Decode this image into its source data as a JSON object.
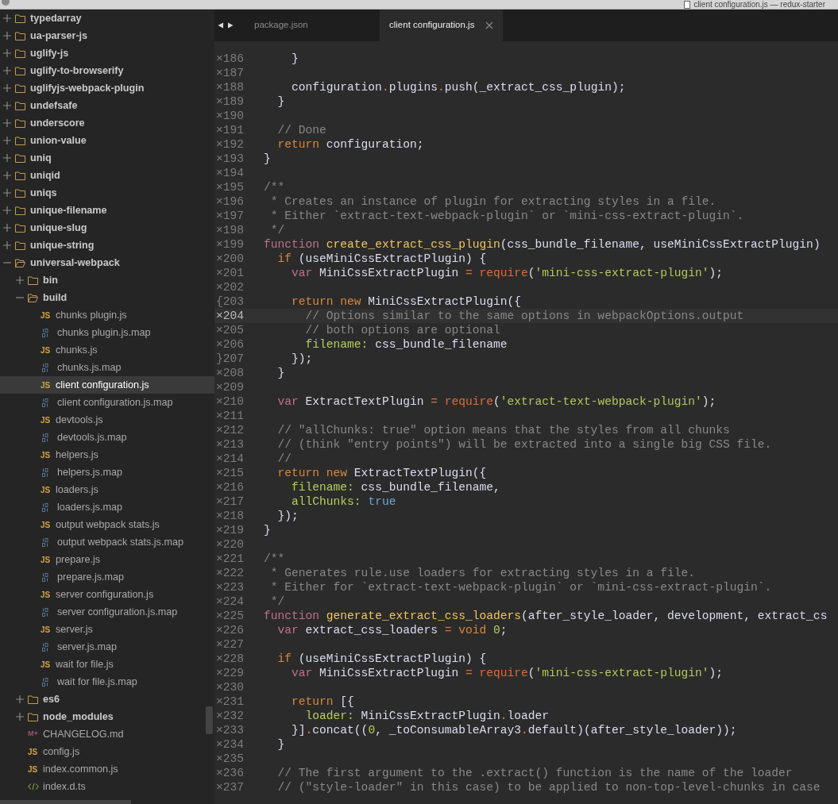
{
  "window": {
    "title": "client configuration.js — redux-starter"
  },
  "sidebar": {
    "items": [
      {
        "kind": "folder",
        "label": "typedarray",
        "expanded": false,
        "selected": false
      },
      {
        "kind": "folder",
        "label": "ua-parser-js",
        "expanded": false,
        "selected": false
      },
      {
        "kind": "folder",
        "label": "uglify-js",
        "expanded": false,
        "selected": false
      },
      {
        "kind": "folder",
        "label": "uglify-to-browserify",
        "expanded": false,
        "selected": false
      },
      {
        "kind": "folder",
        "label": "uglifyjs-webpack-plugin",
        "expanded": false,
        "selected": false
      },
      {
        "kind": "folder",
        "label": "undefsafe",
        "expanded": false,
        "selected": false
      },
      {
        "kind": "folder",
        "label": "underscore",
        "expanded": false,
        "selected": false
      },
      {
        "kind": "folder",
        "label": "union-value",
        "expanded": false,
        "selected": false
      },
      {
        "kind": "folder",
        "label": "uniq",
        "expanded": false,
        "selected": false
      },
      {
        "kind": "folder",
        "label": "uniqid",
        "expanded": false,
        "selected": false
      },
      {
        "kind": "folder",
        "label": "uniqs",
        "expanded": false,
        "selected": false
      },
      {
        "kind": "folder",
        "label": "unique-filename",
        "expanded": false,
        "selected": false
      },
      {
        "kind": "folder",
        "label": "unique-slug",
        "expanded": false,
        "selected": false
      },
      {
        "kind": "folder",
        "label": "unique-string",
        "expanded": false,
        "selected": false
      },
      {
        "kind": "folder",
        "label": "universal-webpack",
        "expanded": true,
        "selected": false,
        "children": [
          {
            "kind": "folder",
            "label": "bin",
            "expanded": false,
            "selected": false
          },
          {
            "kind": "folder",
            "label": "build",
            "expanded": true,
            "selected": false,
            "children": [
              {
                "kind": "js",
                "icon_text": "JS",
                "label": "chunks plugin.js",
                "selected": false
              },
              {
                "kind": "map",
                "label": "chunks plugin.js.map",
                "selected": false
              },
              {
                "kind": "js",
                "icon_text": "JS",
                "label": "chunks.js",
                "selected": false
              },
              {
                "kind": "map",
                "label": "chunks.js.map",
                "selected": false
              },
              {
                "kind": "js",
                "icon_text": "JS",
                "label": "client configuration.js",
                "selected": true
              },
              {
                "kind": "map",
                "label": "client configuration.js.map",
                "selected": false
              },
              {
                "kind": "js",
                "icon_text": "JS",
                "label": "devtools.js",
                "selected": false
              },
              {
                "kind": "map",
                "label": "devtools.js.map",
                "selected": false
              },
              {
                "kind": "js",
                "icon_text": "JS",
                "label": "helpers.js",
                "selected": false
              },
              {
                "kind": "map",
                "label": "helpers.js.map",
                "selected": false
              },
              {
                "kind": "js",
                "icon_text": "JS",
                "label": "loaders.js",
                "selected": false
              },
              {
                "kind": "map",
                "label": "loaders.js.map",
                "selected": false
              },
              {
                "kind": "js",
                "icon_text": "JS",
                "label": "output webpack stats.js",
                "selected": false
              },
              {
                "kind": "map",
                "label": "output webpack stats.js.map",
                "selected": false
              },
              {
                "kind": "js",
                "icon_text": "JS",
                "label": "prepare.js",
                "selected": false
              },
              {
                "kind": "map",
                "label": "prepare.js.map",
                "selected": false
              },
              {
                "kind": "js",
                "icon_text": "JS",
                "label": "server configuration.js",
                "selected": false
              },
              {
                "kind": "map",
                "label": "server configuration.js.map",
                "selected": false
              },
              {
                "kind": "js",
                "icon_text": "JS",
                "label": "server.js",
                "selected": false
              },
              {
                "kind": "map",
                "label": "server.js.map",
                "selected": false
              },
              {
                "kind": "js",
                "icon_text": "JS",
                "label": "wait for file.js",
                "selected": false
              },
              {
                "kind": "map",
                "label": "wait for file.js.map",
                "selected": false
              }
            ]
          },
          {
            "kind": "folder",
            "label": "es6",
            "expanded": false,
            "selected": false
          },
          {
            "kind": "folder",
            "label": "node_modules",
            "expanded": false,
            "selected": false
          },
          {
            "kind": "md",
            "icon_text": "M+",
            "label": "CHANGELOG.md",
            "selected": false
          },
          {
            "kind": "js",
            "icon_text": "JS",
            "label": "config.js",
            "selected": false
          },
          {
            "kind": "js",
            "icon_text": "JS",
            "label": "index.common.js",
            "selected": false
          },
          {
            "kind": "ts",
            "label": "index.d.ts",
            "selected": false
          }
        ]
      }
    ]
  },
  "tabs": [
    {
      "label": "package.json",
      "selected": false
    },
    {
      "label": "client configuration.js",
      "selected": true
    }
  ],
  "editor": {
    "lines": [
      {
        "marker": "×",
        "number": "186",
        "current": false,
        "tokens": [
          {
            "kind": "plain",
            "text": "    }"
          }
        ]
      },
      {
        "marker": "×",
        "number": "187",
        "current": false
      },
      {
        "marker": "×",
        "number": "188",
        "current": false,
        "tokens": [
          {
            "kind": "plain",
            "text": "    configuration"
          },
          {
            "kind": "op",
            "text": "."
          },
          {
            "kind": "plain",
            "text": "plugins"
          },
          {
            "kind": "op",
            "text": "."
          },
          {
            "kind": "plain",
            "text": "push(_extract_css_plugin);"
          }
        ]
      },
      {
        "marker": "×",
        "number": "189",
        "current": false,
        "tokens": [
          {
            "kind": "plain",
            "text": "  }"
          }
        ]
      },
      {
        "marker": "×",
        "number": "190",
        "current": false
      },
      {
        "marker": "×",
        "number": "191",
        "current": false,
        "tokens": [
          {
            "kind": "comment",
            "text": "  // Done"
          }
        ]
      },
      {
        "marker": "×",
        "number": "192",
        "current": false,
        "tokens": [
          {
            "kind": "keyword",
            "text": "  return"
          },
          {
            "kind": "plain",
            "text": " configuration;"
          }
        ]
      },
      {
        "marker": "×",
        "number": "193",
        "current": false,
        "tokens": [
          {
            "kind": "plain",
            "text": "}"
          }
        ]
      },
      {
        "marker": "×",
        "number": "194",
        "current": false
      },
      {
        "marker": "×",
        "number": "195",
        "current": false,
        "tokens": [
          {
            "kind": "comment",
            "text": "/**"
          }
        ]
      },
      {
        "marker": "×",
        "number": "196",
        "current": false,
        "tokens": [
          {
            "kind": "comment",
            "text": " * Creates an instance of plugin for extracting styles in a file."
          }
        ]
      },
      {
        "marker": "×",
        "number": "197",
        "current": false,
        "tokens": [
          {
            "kind": "comment",
            "text": " * Either `extract-text-webpack-plugin` or `mini-css-extract-plugin`."
          }
        ]
      },
      {
        "marker": "×",
        "number": "198",
        "current": false,
        "tokens": [
          {
            "kind": "comment",
            "text": " */"
          }
        ]
      },
      {
        "marker": "×",
        "number": "199",
        "current": false,
        "tokens": [
          {
            "kind": "storage",
            "text": "function "
          },
          {
            "kind": "name",
            "text": "create_extract_css_plugin"
          },
          {
            "kind": "plain",
            "text": "(css_bundle_filename, useMiniCssExtractPlugin)"
          }
        ]
      },
      {
        "marker": "×",
        "number": "200",
        "current": false,
        "tokens": [
          {
            "kind": "keyword",
            "text": "  if"
          },
          {
            "kind": "plain",
            "text": " (useMiniCssExtractPlugin) {"
          }
        ]
      },
      {
        "marker": "×",
        "number": "201",
        "current": false,
        "tokens": [
          {
            "kind": "storage",
            "text": "    var"
          },
          {
            "kind": "plain",
            "text": " MiniCssExtractPlugin "
          },
          {
            "kind": "call",
            "text": "= require"
          },
          {
            "kind": "plain",
            "text": "("
          },
          {
            "kind": "string",
            "text": "'mini-css-extract-plugin'"
          },
          {
            "kind": "plain",
            "text": ");"
          }
        ]
      },
      {
        "marker": "×",
        "number": "202",
        "current": false
      },
      {
        "marker": "{",
        "number": "203",
        "current": false,
        "tokens": [
          {
            "kind": "keyword",
            "text": "    return new"
          },
          {
            "kind": "plain",
            "text": " MiniCssExtractPlugin({"
          }
        ]
      },
      {
        "marker": "×",
        "number": "204",
        "current": true,
        "tokens": [
          {
            "kind": "comment",
            "text": "      // Options similar to the same options in webpackOptions.output"
          }
        ]
      },
      {
        "marker": "×",
        "number": "205",
        "current": false,
        "tokens": [
          {
            "kind": "comment",
            "text": "      // both options are optional"
          }
        ]
      },
      {
        "marker": "×",
        "number": "206",
        "current": false,
        "tokens": [
          {
            "kind": "key",
            "text": "      filename:"
          },
          {
            "kind": "plain",
            "text": " css_bundle_filename"
          }
        ]
      },
      {
        "marker": "}",
        "number": "207",
        "current": false,
        "tokens": [
          {
            "kind": "plain",
            "text": "    });"
          }
        ]
      },
      {
        "marker": "×",
        "number": "208",
        "current": false,
        "tokens": [
          {
            "kind": "plain",
            "text": "  }"
          }
        ]
      },
      {
        "marker": "×",
        "number": "209",
        "current": false
      },
      {
        "marker": "×",
        "number": "210",
        "current": false,
        "tokens": [
          {
            "kind": "storage",
            "text": "  var"
          },
          {
            "kind": "plain",
            "text": " ExtractTextPlugin "
          },
          {
            "kind": "call",
            "text": "= require"
          },
          {
            "kind": "plain",
            "text": "("
          },
          {
            "kind": "string",
            "text": "'extract-text-webpack-plugin'"
          },
          {
            "kind": "plain",
            "text": ");"
          }
        ]
      },
      {
        "marker": "×",
        "number": "211",
        "current": false
      },
      {
        "marker": "×",
        "number": "212",
        "current": false,
        "tokens": [
          {
            "kind": "comment",
            "text": "  // \"allChunks: true\" option means that the styles from all chunks"
          }
        ]
      },
      {
        "marker": "×",
        "number": "213",
        "current": false,
        "tokens": [
          {
            "kind": "comment",
            "text": "  // (think \"entry points\") will be extracted into a single big CSS file."
          }
        ]
      },
      {
        "marker": "×",
        "number": "214",
        "current": false,
        "tokens": [
          {
            "kind": "comment",
            "text": "  //"
          }
        ]
      },
      {
        "marker": "×",
        "number": "215",
        "current": false,
        "tokens": [
          {
            "kind": "keyword",
            "text": "  return new"
          },
          {
            "kind": "plain",
            "text": " ExtractTextPlugin({"
          }
        ]
      },
      {
        "marker": "×",
        "number": "216",
        "current": false,
        "tokens": [
          {
            "kind": "key",
            "text": "    filename:"
          },
          {
            "kind": "plain",
            "text": " css_bundle_filename,"
          }
        ]
      },
      {
        "marker": "×",
        "number": "217",
        "current": false,
        "tokens": [
          {
            "kind": "key",
            "text": "    allChunks: "
          },
          {
            "kind": "constant",
            "text": "true"
          }
        ]
      },
      {
        "marker": "×",
        "number": "218",
        "current": false,
        "tokens": [
          {
            "kind": "plain",
            "text": "  });"
          }
        ]
      },
      {
        "marker": "×",
        "number": "219",
        "current": false,
        "tokens": [
          {
            "kind": "plain",
            "text": "}"
          }
        ]
      },
      {
        "marker": "×",
        "number": "220",
        "current": false
      },
      {
        "marker": "×",
        "number": "221",
        "current": false,
        "tokens": [
          {
            "kind": "comment",
            "text": "/**"
          }
        ]
      },
      {
        "marker": "×",
        "number": "222",
        "current": false,
        "tokens": [
          {
            "kind": "comment",
            "text": " * Generates rule.use loaders for extracting styles in a file."
          }
        ]
      },
      {
        "marker": "×",
        "number": "223",
        "current": false,
        "tokens": [
          {
            "kind": "comment",
            "text": " * Either for `extract-text-webpack-plugin` or `mini-css-extract-plugin`."
          }
        ]
      },
      {
        "marker": "×",
        "number": "224",
        "current": false,
        "tokens": [
          {
            "kind": "comment",
            "text": " */"
          }
        ]
      },
      {
        "marker": "×",
        "number": "225",
        "current": false,
        "tokens": [
          {
            "kind": "storage",
            "text": "function "
          },
          {
            "kind": "name",
            "text": "generate_extract_css_loaders"
          },
          {
            "kind": "plain",
            "text": "(after_style_loader, development, extract_cs"
          }
        ]
      },
      {
        "marker": "×",
        "number": "226",
        "current": false,
        "tokens": [
          {
            "kind": "storage",
            "text": "  var"
          },
          {
            "kind": "plain",
            "text": " extract_css_loaders "
          },
          {
            "kind": "call",
            "text": "="
          },
          {
            "kind": "keyword",
            "text": " void "
          },
          {
            "kind": "number",
            "text": "0"
          },
          {
            "kind": "plain",
            "text": ";"
          }
        ]
      },
      {
        "marker": "×",
        "number": "227",
        "current": false
      },
      {
        "marker": "×",
        "number": "228",
        "current": false,
        "tokens": [
          {
            "kind": "keyword",
            "text": "  if"
          },
          {
            "kind": "plain",
            "text": " (useMiniCssExtractPlugin) {"
          }
        ]
      },
      {
        "marker": "×",
        "number": "229",
        "current": false,
        "tokens": [
          {
            "kind": "storage",
            "text": "    var"
          },
          {
            "kind": "plain",
            "text": " MiniCssExtractPlugin "
          },
          {
            "kind": "call",
            "text": "= require"
          },
          {
            "kind": "plain",
            "text": "("
          },
          {
            "kind": "string",
            "text": "'mini-css-extract-plugin'"
          },
          {
            "kind": "plain",
            "text": ");"
          }
        ]
      },
      {
        "marker": "×",
        "number": "230",
        "current": false
      },
      {
        "marker": "×",
        "number": "231",
        "current": false,
        "tokens": [
          {
            "kind": "keyword",
            "text": "    return"
          },
          {
            "kind": "plain",
            "text": " [{"
          }
        ]
      },
      {
        "marker": "×",
        "number": "232",
        "current": false,
        "tokens": [
          {
            "kind": "key",
            "text": "      loader:"
          },
          {
            "kind": "plain",
            "text": " MiniCssExtractPlugin"
          },
          {
            "kind": "op",
            "text": "."
          },
          {
            "kind": "plain",
            "text": "loader"
          }
        ]
      },
      {
        "marker": "×",
        "number": "233",
        "current": false,
        "tokens": [
          {
            "kind": "plain",
            "text": "    }]"
          },
          {
            "kind": "op",
            "text": "."
          },
          {
            "kind": "plain",
            "text": "concat(("
          },
          {
            "kind": "number",
            "text": "0"
          },
          {
            "kind": "plain",
            "text": ", _toConsumableArray3"
          },
          {
            "kind": "op",
            "text": "."
          },
          {
            "kind": "plain",
            "text": "default)(after_style_loader));"
          }
        ]
      },
      {
        "marker": "×",
        "number": "234",
        "current": false,
        "tokens": [
          {
            "kind": "plain",
            "text": "  }"
          }
        ]
      },
      {
        "marker": "×",
        "number": "235",
        "current": false
      },
      {
        "marker": "×",
        "number": "236",
        "current": false,
        "tokens": [
          {
            "kind": "comment",
            "text": "  // The first argument to the .extract() function is the name of the loader"
          }
        ]
      },
      {
        "marker": "×",
        "number": "237",
        "current": false,
        "tokens": [
          {
            "kind": "comment",
            "text": "  // (\"style-loader\" in this case) to be applied to non-top-level-chunks in case"
          }
        ]
      }
    ]
  }
}
